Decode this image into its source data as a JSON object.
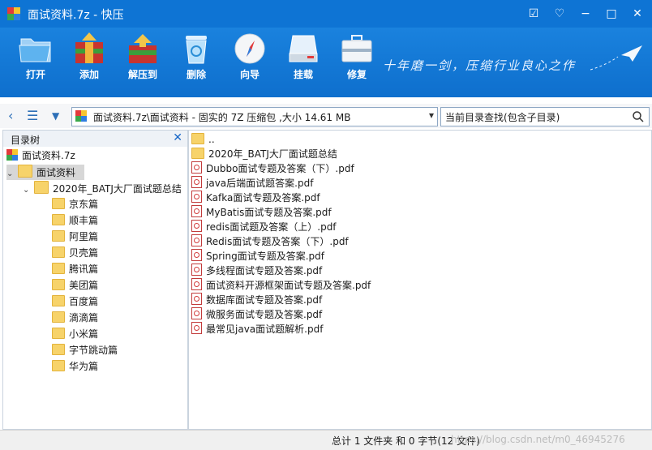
{
  "window": {
    "title": "面试资料.7z - 快压",
    "controls": [
      "☑",
      "♡",
      "−",
      "□",
      "✕"
    ]
  },
  "toolbar": {
    "buttons": [
      {
        "label": "打开",
        "icon": "folder-open-icon"
      },
      {
        "label": "添加",
        "icon": "add-archive-icon"
      },
      {
        "label": "解压到",
        "icon": "extract-icon"
      },
      {
        "label": "删除",
        "icon": "recycle-bin-icon"
      },
      {
        "label": "向导",
        "icon": "compass-icon"
      },
      {
        "label": "挂载",
        "icon": "drive-icon"
      },
      {
        "label": "修复",
        "icon": "toolbox-icon"
      }
    ],
    "slogan": "十年磨一剑，压缩行业良心之作"
  },
  "address": {
    "path": "面试资料.7z\\面试资料 - 固实的 7Z 压缩包 ,大小 14.61 MB",
    "search_placeholder": "当前目录查找(包含子目录)"
  },
  "tree": {
    "header": "目录树",
    "root": "面试资料.7z",
    "level1": "面试资料",
    "level2": "2020年_BATJ大厂面试题总结",
    "children": [
      "京东篇",
      "顺丰篇",
      "阿里篇",
      "贝壳篇",
      "腾讯篇",
      "美团篇",
      "百度篇",
      "滴滴篇",
      "小米篇",
      "字节跳动篇",
      "华为篇"
    ]
  },
  "files": {
    "up": "..",
    "folder": "2020年_BATJ大厂面试题总结",
    "items": [
      "Dubbo面试专题及答案（下）.pdf",
      "java后端面试题答案.pdf",
      "Kafka面试专题及答案.pdf",
      "MyBatis面试专题及答案.pdf",
      "redis面试题及答案（上）.pdf",
      "Redis面试专题及答案（下）.pdf",
      "Spring面试专题及答案.pdf",
      "多线程面试专题及答案.pdf",
      "面试资料开源框架面试专题及答案.pdf",
      "数据库面试专题及答案.pdf",
      "微服务面试专题及答案.pdf",
      "最常见java面试题解析.pdf"
    ]
  },
  "status": {
    "summary": "总计 1 文件夹 和 0 字节(12 文件)",
    "watermark": "https://blog.csdn.net/m0_46945276"
  }
}
